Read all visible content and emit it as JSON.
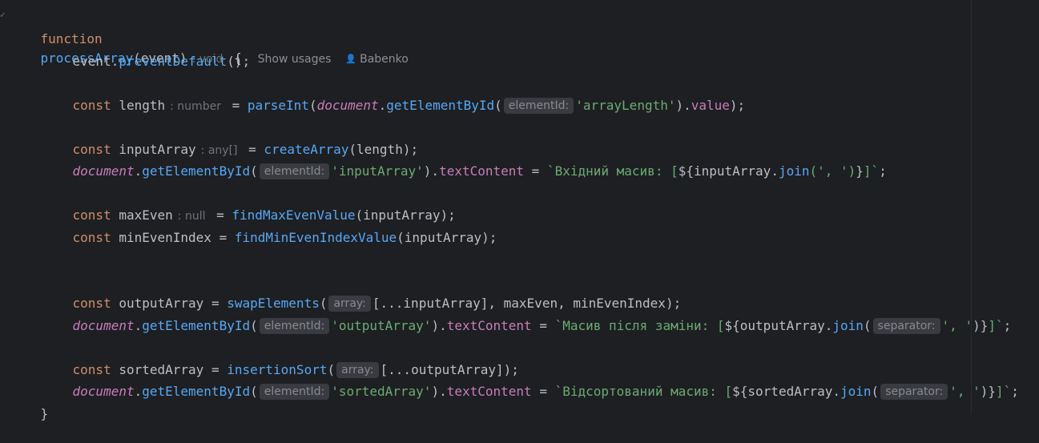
{
  "code": {
    "l1": {
      "kw": "function",
      "name": "processArray",
      "params": "(event)",
      "ret": ": void",
      "brace": "{",
      "usages": "Show usages",
      "author": "Babenko"
    },
    "l2": {
      "obj": "event.",
      "fn": "preventDefault",
      "rest": "();"
    },
    "l4": {
      "kw": "const",
      "var": "length",
      "hint": ": number",
      "eq": "=",
      "fn": "parseInt",
      "glob": "document",
      "fn2": "getElementById",
      "param": "elementId:",
      "str": "'arrayLength'",
      "mid": ").",
      "prop": "value",
      "end": ");"
    },
    "l6": {
      "kw": "const",
      "var": "inputArray",
      "hint": ": any[]",
      "eq": "=",
      "fn": "createArray",
      "rest": "(length);"
    },
    "l7": {
      "glob": "document",
      "fn": "getElementById",
      "param": "elementId:",
      "str": "'inputArray'",
      "mid": ").",
      "prop": "textContent",
      "eq": "=",
      "tpl1": "`Вхідний масив: [",
      "interp1": "${inputArray.",
      "join": "join",
      "args": "(', ')",
      "interp2": "}",
      "tpl2": "]`",
      "semi": ";"
    },
    "l9": {
      "kw": "const",
      "var": "maxEven",
      "hint": ": null",
      "eq": "=",
      "fn": "findMaxEvenValue",
      "rest": "(inputArray);"
    },
    "l10": {
      "kw": "const",
      "var": "minEvenIndex",
      "eq": "=",
      "fn": "findMinEvenIndexValue",
      "rest": "(inputArray);"
    },
    "l13": {
      "kw": "const",
      "var": "outputArray",
      "eq": "=",
      "fn": "swapElements",
      "param": "array:",
      "rest": "[...inputArray], maxEven, minEvenIndex);"
    },
    "l14": {
      "glob": "document",
      "fn": "getElementById",
      "param": "elementId:",
      "str": "'outputArray'",
      "mid": ").",
      "prop": "textContent",
      "eq": "=",
      "tpl1": "`Масив після заміни: [",
      "interp1": "${outputArray.",
      "join": "join",
      "param2": "separator:",
      "sep": "', '",
      "interp2": ")}",
      "tpl2": "]`",
      "semi": ";"
    },
    "l16": {
      "kw": "const",
      "var": "sortedArray",
      "eq": "=",
      "fn": "insertionSort",
      "param": "array:",
      "rest": "[...outputArray]);"
    },
    "l17": {
      "glob": "document",
      "fn": "getElementById",
      "param": "elementId:",
      "str": "'sortedArray'",
      "mid": ").",
      "prop": "textContent",
      "eq": "=",
      "tpl1": "`Відсортований масив: [",
      "interp1": "${sortedArray.",
      "join": "join",
      "param2": "separator:",
      "sep": "', '",
      "interp2": ")}",
      "tpl2": "]`",
      "semi": ";"
    },
    "l18": {
      "brace": "}"
    }
  },
  "colors": {
    "background": "#1e1f22",
    "keyword": "#cf8e6d",
    "function": "#56a8f5",
    "string": "#6aab73",
    "global": "#c77dbb",
    "text": "#bcbec4",
    "hint_bg": "#393b40"
  }
}
